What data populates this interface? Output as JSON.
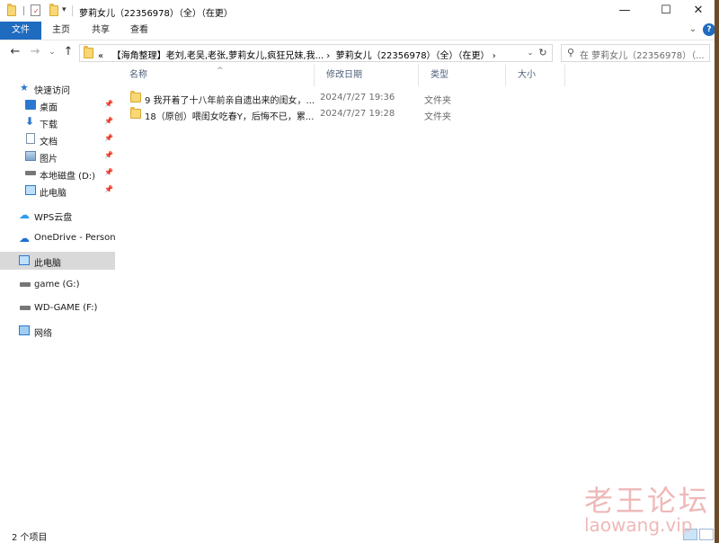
{
  "window": {
    "title": "萝莉女儿（22356978）（全）（在更）",
    "controls": {
      "minimize": "—",
      "maximize": "☐",
      "close": "✕"
    }
  },
  "quick_access_toolbar": {
    "customize": "▾"
  },
  "ribbon": {
    "tabs": [
      "文件",
      "主页",
      "共享",
      "查看"
    ],
    "active_tab": "文件",
    "expand": "⌄",
    "help": "?"
  },
  "nav": {
    "back": "←",
    "forward": "→",
    "recent": "⌄",
    "up": "↑",
    "address": {
      "overflow": "«",
      "segments": [
        "【海角整理】老刘,老吴,老张,萝莉女儿,疯狂兄妹,我...",
        "萝莉女儿（22356978）（全）（在更）"
      ],
      "separator": "›",
      "dropdown": "⌄",
      "refresh": "↻"
    },
    "search": {
      "placeholder": "在 萝莉女儿（22356978）（...",
      "icon": "⚲"
    }
  },
  "sidebar": {
    "items": [
      {
        "label": "快速访问",
        "icon": "star-icon",
        "pinned": false
      },
      {
        "label": "桌面",
        "icon": "desktop-icon",
        "pinned": true
      },
      {
        "label": "下载",
        "icon": "download-icon",
        "pinned": true
      },
      {
        "label": "文档",
        "icon": "document-icon",
        "pinned": true
      },
      {
        "label": "图片",
        "icon": "picture-icon",
        "pinned": true
      },
      {
        "label": "本地磁盘 (D:)",
        "icon": "drive-icon",
        "pinned": true
      },
      {
        "label": "此电脑",
        "icon": "computer-icon",
        "pinned": true
      },
      {
        "label": "WPS云盘",
        "icon": "cloud-icon",
        "pinned": false
      },
      {
        "label": "OneDrive - Personal",
        "icon": "onedrive-icon",
        "pinned": false
      },
      {
        "label": "此电脑",
        "icon": "computer-icon",
        "pinned": false,
        "selected": true
      },
      {
        "label": "game (G:)",
        "icon": "drive-icon",
        "pinned": false
      },
      {
        "label": "WD-GAME (F:)",
        "icon": "drive-icon",
        "pinned": false
      },
      {
        "label": "网络",
        "icon": "network-icon",
        "pinned": false
      }
    ]
  },
  "columns": [
    "名称",
    "修改日期",
    "类型",
    "大小"
  ],
  "sort_arrow": "^",
  "files": [
    {
      "name": "9 我开着了十八年前亲自遗出来的闺女，...",
      "modified": "2024/7/27 19:36",
      "type": "文件夹",
      "size": ""
    },
    {
      "name": "18（原创）喂闺女吃春Y，后悔不已，累...",
      "modified": "2024/7/27 19:28",
      "type": "文件夹",
      "size": ""
    }
  ],
  "status": {
    "count": "2 个项目"
  },
  "watermark": {
    "line1": "老王论坛",
    "line2": "laowang.vip"
  },
  "colors": {
    "accent": "#1f6bbf",
    "folder": "#f8d775",
    "selected": "#d9d9d9",
    "header_text": "#4c607a"
  }
}
